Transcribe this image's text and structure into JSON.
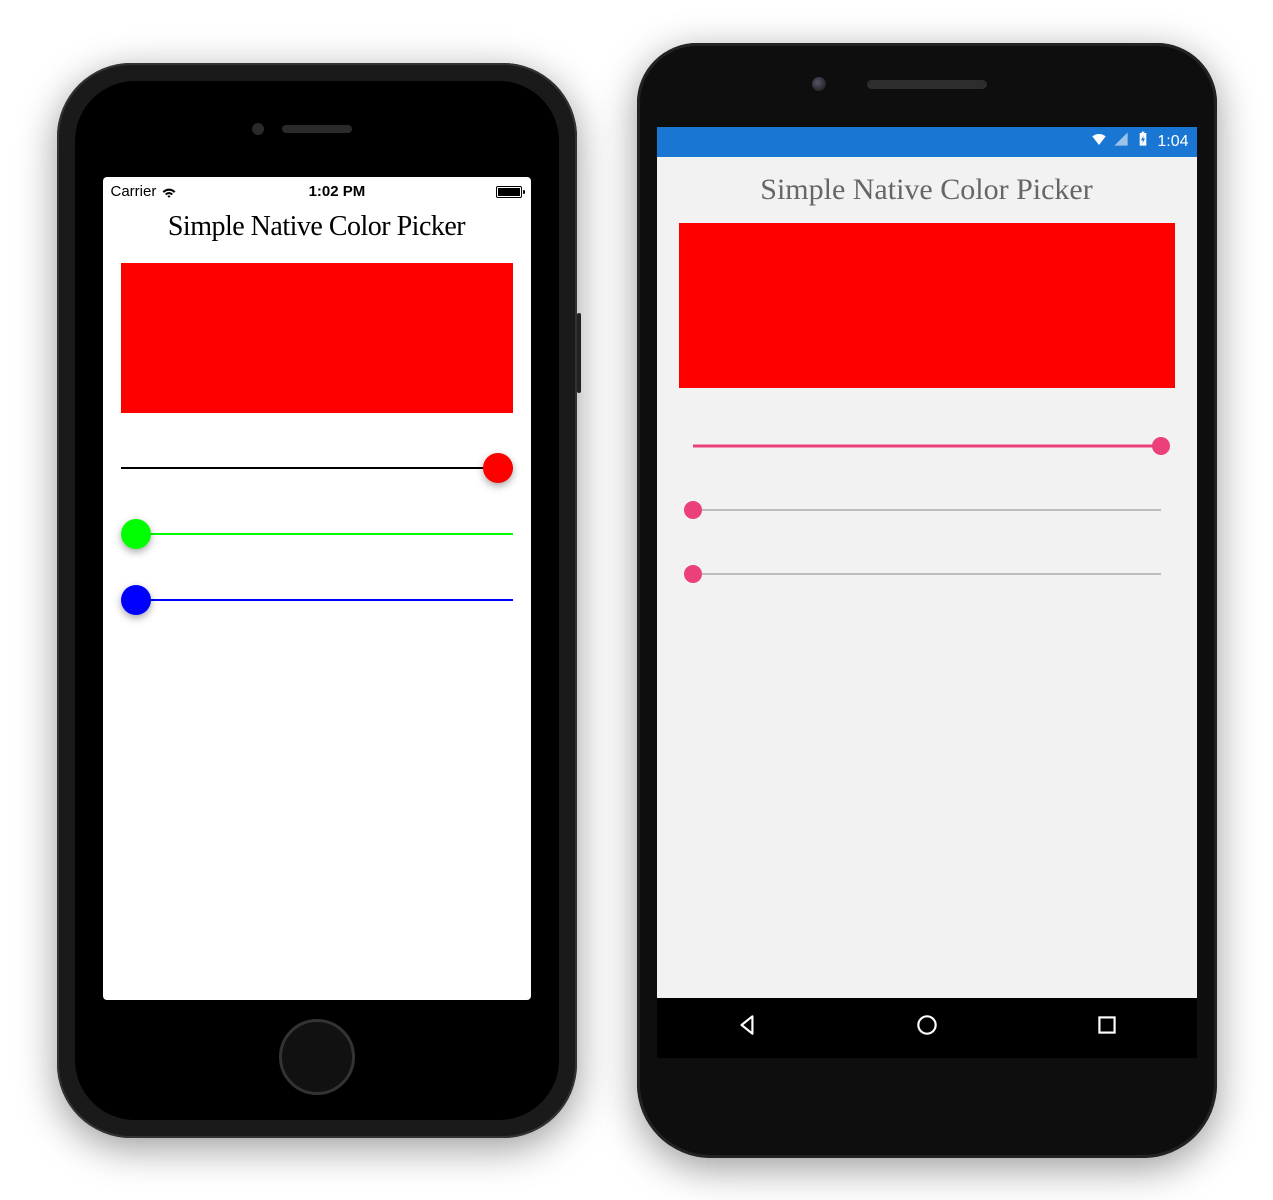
{
  "ios": {
    "statusbar": {
      "carrier": "Carrier",
      "time": "1:02 PM"
    },
    "app_title": "Simple Native Color Picker",
    "swatch_color": "#ff0000",
    "sliders": [
      {
        "value": 1.0,
        "thumb_color": "#ff0000",
        "filled_color": "#000000",
        "remaining_color": "#000000"
      },
      {
        "value": 0.0,
        "thumb_color": "#00ff00",
        "filled_color": "#00ff00",
        "remaining_color": "#00ff00"
      },
      {
        "value": 0.0,
        "thumb_color": "#0000ff",
        "filled_color": "#0000ff",
        "remaining_color": "#0000ff"
      }
    ]
  },
  "android": {
    "statusbar": {
      "time": "1:04"
    },
    "app_title": "Simple Native Color Picker",
    "swatch_color": "#ff0000",
    "accent": "#ec407a",
    "sliders": [
      {
        "value": 1.0
      },
      {
        "value": 0.0
      },
      {
        "value": 0.0
      }
    ]
  }
}
